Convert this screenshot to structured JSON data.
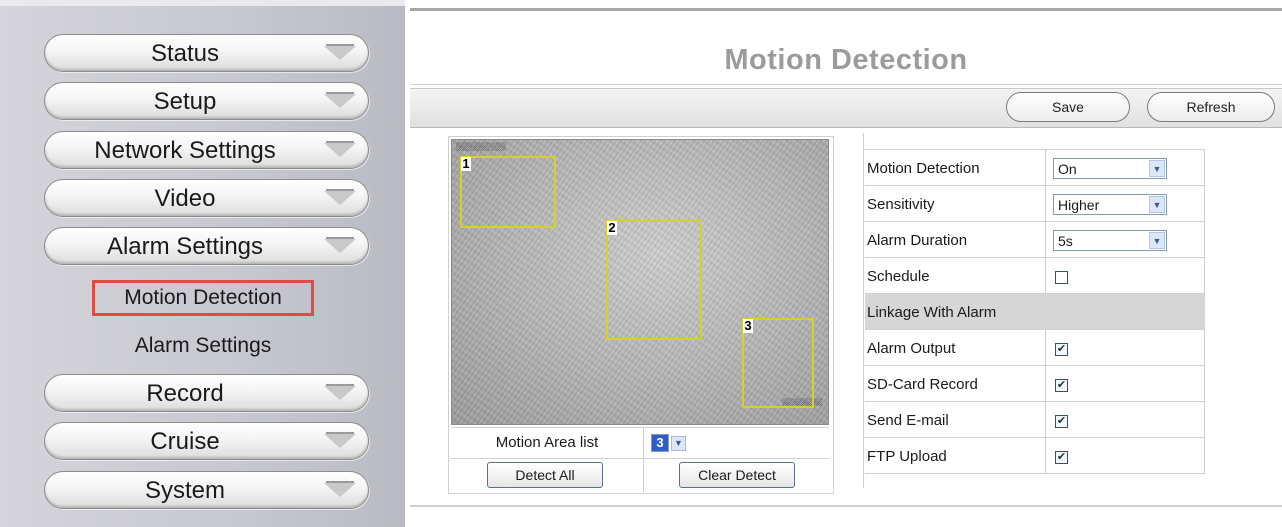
{
  "sidebar": {
    "menu": [
      {
        "label": "Status"
      },
      {
        "label": "Setup"
      },
      {
        "label": "Network Settings"
      },
      {
        "label": "Video"
      },
      {
        "label": "Alarm Settings"
      },
      {
        "label": "Record"
      },
      {
        "label": "Cruise"
      },
      {
        "label": "System"
      }
    ],
    "submenu": [
      {
        "label": "Motion Detection",
        "highlighted": true
      },
      {
        "label": "Alarm Settings",
        "highlighted": false
      }
    ]
  },
  "page": {
    "title": "Motion Detection",
    "save_label": "Save",
    "refresh_label": "Refresh"
  },
  "camera": {
    "zones": [
      "1",
      "2",
      "3"
    ],
    "area_list_label": "Motion Area list",
    "area_selected": "3",
    "detect_all_label": "Detect All",
    "clear_detect_label": "Clear Detect"
  },
  "settings": {
    "rows": [
      {
        "label": "Motion Detection",
        "type": "select",
        "value": "On"
      },
      {
        "label": "Sensitivity",
        "type": "select",
        "value": "Higher"
      },
      {
        "label": "Alarm Duration",
        "type": "select",
        "value": "5s"
      },
      {
        "label": "Schedule",
        "type": "checkbox",
        "checked": false
      },
      {
        "label": "Linkage With Alarm",
        "type": "header"
      },
      {
        "label": "Alarm Output",
        "type": "checkbox",
        "checked": true
      },
      {
        "label": "SD-Card Record",
        "type": "checkbox",
        "checked": true
      },
      {
        "label": "Send E-mail",
        "type": "checkbox",
        "checked": true
      },
      {
        "label": "FTP Upload",
        "type": "checkbox",
        "checked": true
      }
    ]
  },
  "icons": {
    "dropdown": "chevron-down-icon",
    "check": "checkmark-icon"
  },
  "colors": {
    "highlight_border": "#e14a45",
    "zone_outline": "#d8cf2a",
    "title_gray": "#9b9b9b"
  }
}
